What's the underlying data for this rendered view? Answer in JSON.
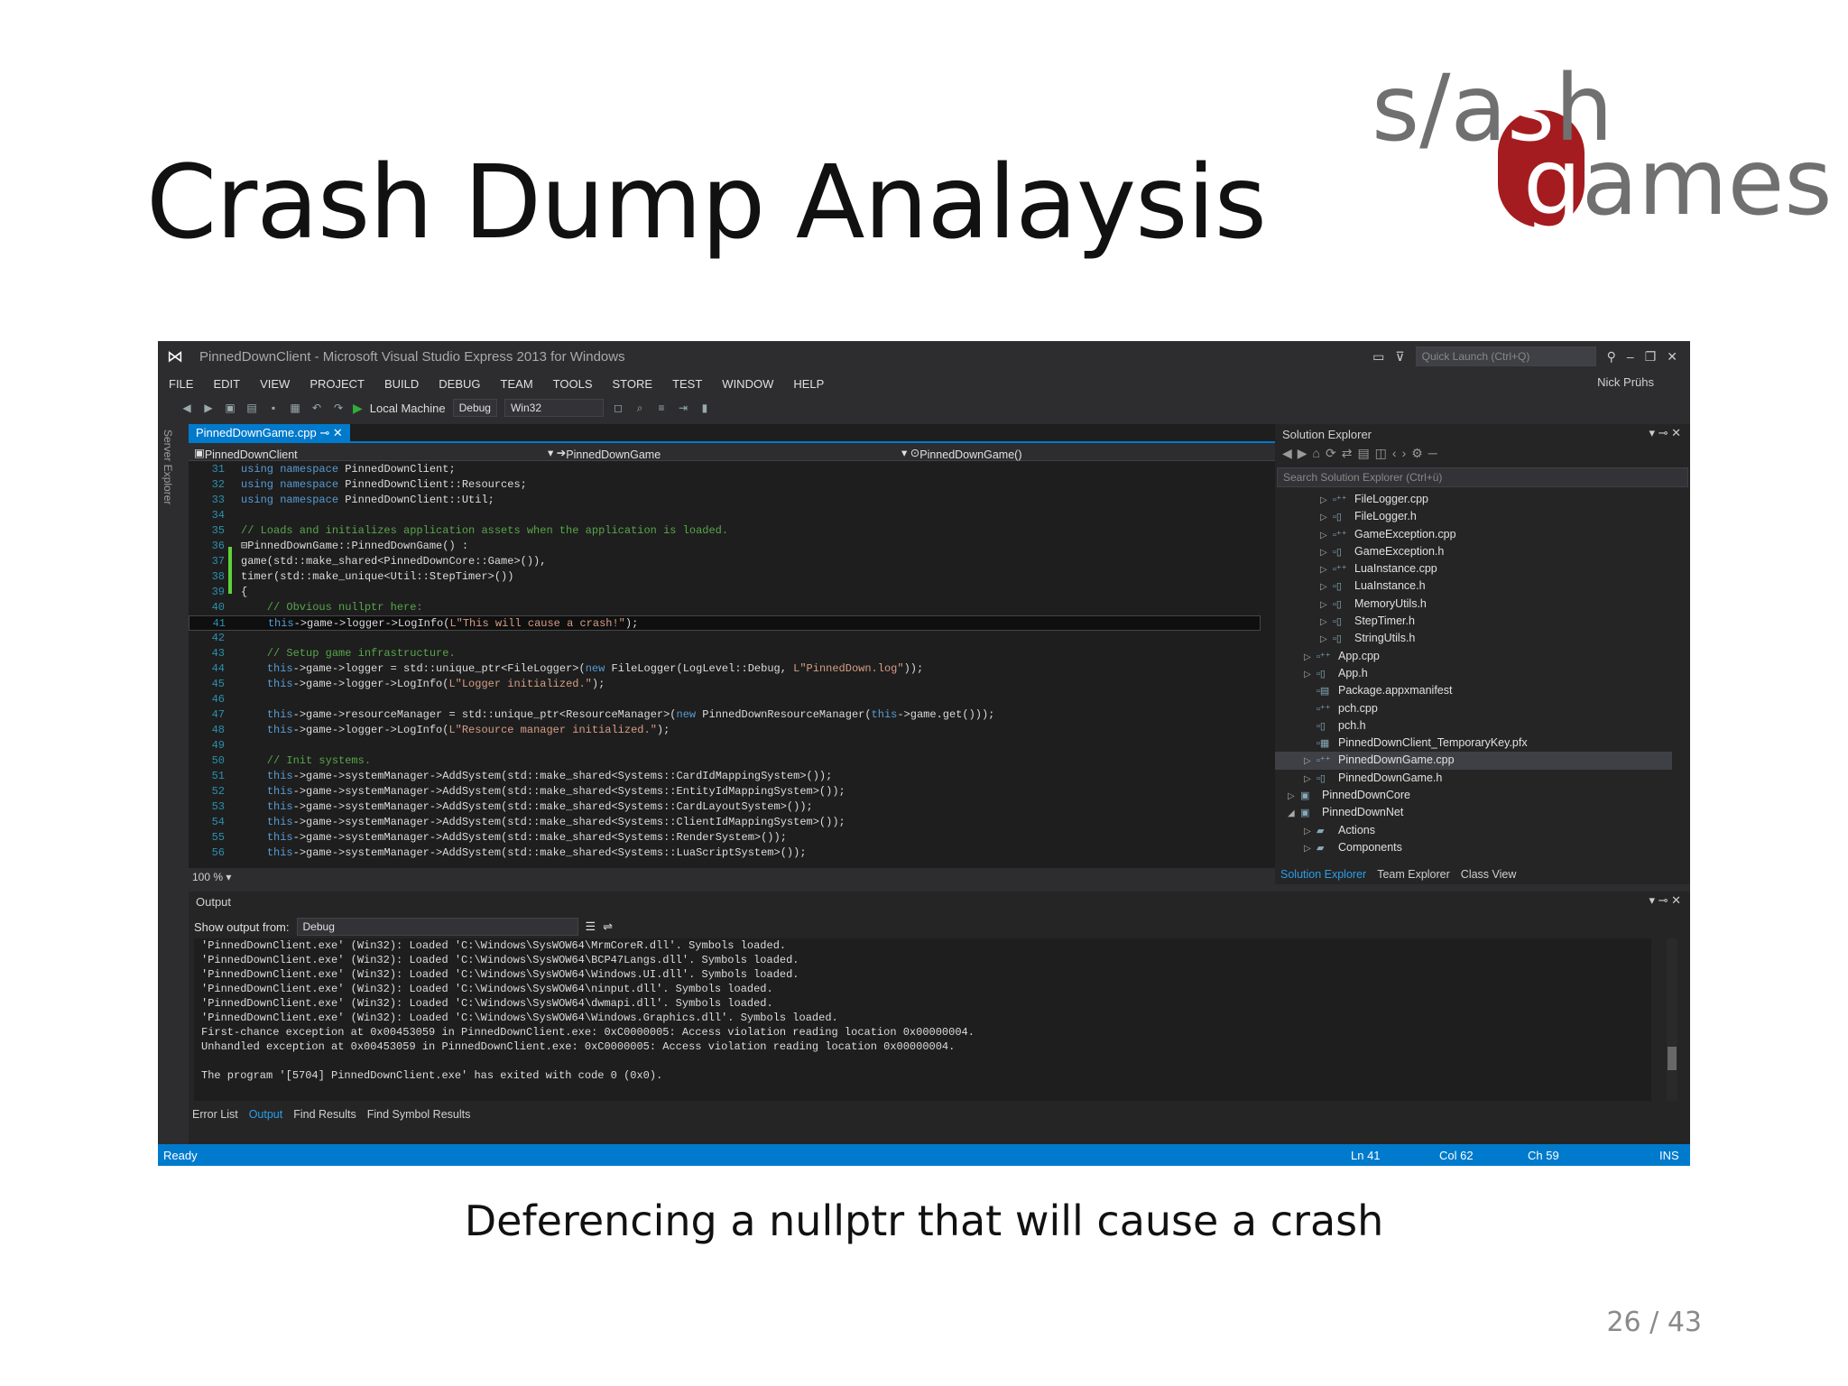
{
  "slide": {
    "title": "Crash Dump Analaysis",
    "caption": "Deferencing a nullptr that will cause a crash",
    "page": "26 / 43",
    "logo": {
      "top": "s/ash",
      "bottom": "games",
      "accent": "#a41c1f"
    }
  },
  "window": {
    "title": "PinnedDownClient - Microsoft Visual Studio Express 2013 for Windows",
    "quick_launch_placeholder": "Quick Launch (Ctrl+Q)",
    "user": "Nick Prühs"
  },
  "menu": [
    "FILE",
    "EDIT",
    "VIEW",
    "PROJECT",
    "BUILD",
    "DEBUG",
    "TEAM",
    "TOOLS",
    "STORE",
    "TEST",
    "WINDOW",
    "HELP"
  ],
  "toolbar": {
    "run_target": "Local Machine",
    "configuration": "Debug",
    "platform": "Win32"
  },
  "sidebar_tab": "Server Explorer",
  "editor": {
    "tab": "PinnedDownGame.cpp",
    "nav_project": "PinnedDownClient",
    "nav_class": "PinnedDownGame",
    "nav_member": "PinnedDownGame()",
    "zoom": "100 %",
    "lines": [
      {
        "n": "31",
        "t": "using namespace PinnedDownClient;"
      },
      {
        "n": "32",
        "t": "using namespace PinnedDownClient::Resources;"
      },
      {
        "n": "33",
        "t": "using namespace PinnedDownClient::Util;"
      },
      {
        "n": "34",
        "t": ""
      },
      {
        "n": "35",
        "t": "// Loads and initializes application assets when the application is loaded."
      },
      {
        "n": "36",
        "t": "⊟PinnedDownGame::PinnedDownGame() :"
      },
      {
        "n": "37",
        "t": "game(std::make_shared<PinnedDownCore::Game>()),"
      },
      {
        "n": "38",
        "t": "timer(std::make_unique<Util::StepTimer>())"
      },
      {
        "n": "39",
        "t": "{"
      },
      {
        "n": "40",
        "t": "    // Obvious nullptr here:"
      },
      {
        "n": "41",
        "t": "    this->game->logger->LogInfo(L\"This will cause a crash!\");"
      },
      {
        "n": "42",
        "t": ""
      },
      {
        "n": "43",
        "t": "    // Setup game infrastructure."
      },
      {
        "n": "44",
        "t": "    this->game->logger = std::unique_ptr<FileLogger>(new FileLogger(LogLevel::Debug, L\"PinnedDown.log\"));"
      },
      {
        "n": "45",
        "t": "    this->game->logger->LogInfo(L\"Logger initialized.\");"
      },
      {
        "n": "46",
        "t": ""
      },
      {
        "n": "47",
        "t": "    this->game->resourceManager = std::unique_ptr<ResourceManager>(new PinnedDownResourceManager(this->game.get()));"
      },
      {
        "n": "48",
        "t": "    this->game->logger->LogInfo(L\"Resource manager initialized.\");"
      },
      {
        "n": "49",
        "t": ""
      },
      {
        "n": "50",
        "t": "    // Init systems."
      },
      {
        "n": "51",
        "t": "    this->game->systemManager->AddSystem(std::make_shared<Systems::CardIdMappingSystem>());"
      },
      {
        "n": "52",
        "t": "    this->game->systemManager->AddSystem(std::make_shared<Systems::EntityIdMappingSystem>());"
      },
      {
        "n": "53",
        "t": "    this->game->systemManager->AddSystem(std::make_shared<Systems::CardLayoutSystem>());"
      },
      {
        "n": "54",
        "t": "    this->game->systemManager->AddSystem(std::make_shared<Systems::ClientIdMappingSystem>());"
      },
      {
        "n": "55",
        "t": "    this->game->systemManager->AddSystem(std::make_shared<Systems::RenderSystem>());"
      },
      {
        "n": "56",
        "t": "    this->game->systemManager->AddSystem(std::make_shared<Systems::LuaScriptSystem>());"
      }
    ]
  },
  "solution_explorer": {
    "title": "Solution Explorer",
    "search_placeholder": "Search Solution Explorer (Ctrl+ü)",
    "items": [
      {
        "label": "FileLogger.cpp",
        "depth": 3,
        "arrow": "▷",
        "icon": "cpp-file-icon"
      },
      {
        "label": "FileLogger.h",
        "depth": 3,
        "arrow": "▷",
        "icon": "header-file-icon"
      },
      {
        "label": "GameException.cpp",
        "depth": 3,
        "arrow": "▷",
        "icon": "cpp-file-icon"
      },
      {
        "label": "GameException.h",
        "depth": 3,
        "arrow": "▷",
        "icon": "header-file-icon"
      },
      {
        "label": "LuaInstance.cpp",
        "depth": 3,
        "arrow": "▷",
        "icon": "cpp-file-icon"
      },
      {
        "label": "LuaInstance.h",
        "depth": 3,
        "arrow": "▷",
        "icon": "header-file-icon"
      },
      {
        "label": "MemoryUtils.h",
        "depth": 3,
        "arrow": "▷",
        "icon": "header-file-icon"
      },
      {
        "label": "StepTimer.h",
        "depth": 3,
        "arrow": "▷",
        "icon": "header-file-icon"
      },
      {
        "label": "StringUtils.h",
        "depth": 3,
        "arrow": "▷",
        "icon": "header-file-icon"
      },
      {
        "label": "App.cpp",
        "depth": 2,
        "arrow": "▷",
        "icon": "cpp-file-icon"
      },
      {
        "label": "App.h",
        "depth": 2,
        "arrow": "▷",
        "icon": "header-file-icon"
      },
      {
        "label": "Package.appxmanifest",
        "depth": 2,
        "arrow": "",
        "icon": "manifest-file-icon"
      },
      {
        "label": "pch.cpp",
        "depth": 2,
        "arrow": "",
        "icon": "cpp-file-icon"
      },
      {
        "label": "pch.h",
        "depth": 2,
        "arrow": "",
        "icon": "header-file-icon"
      },
      {
        "label": "PinnedDownClient_TemporaryKey.pfx",
        "depth": 2,
        "arrow": "",
        "icon": "certificate-file-icon"
      },
      {
        "label": "PinnedDownGame.cpp",
        "depth": 2,
        "arrow": "▷",
        "icon": "cpp-file-icon",
        "selected": true
      },
      {
        "label": "PinnedDownGame.h",
        "depth": 2,
        "arrow": "▷",
        "icon": "header-file-icon"
      },
      {
        "label": "PinnedDownCore",
        "depth": 1,
        "arrow": "▷",
        "icon": "project-icon"
      },
      {
        "label": "PinnedDownNet",
        "depth": 1,
        "arrow": "◢",
        "icon": "project-icon"
      },
      {
        "label": "Actions",
        "depth": 2,
        "arrow": "▷",
        "icon": "folder-icon"
      },
      {
        "label": "Components",
        "depth": 2,
        "arrow": "▷",
        "icon": "folder-icon"
      }
    ],
    "tabs": [
      "Solution Explorer",
      "Team Explorer",
      "Class View"
    ]
  },
  "output": {
    "title": "Output",
    "show_from_label": "Show output from:",
    "source": "Debug",
    "lines": [
      "'PinnedDownClient.exe' (Win32): Loaded 'C:\\Windows\\SysWOW64\\MrmCoreR.dll'. Symbols loaded.",
      "'PinnedDownClient.exe' (Win32): Loaded 'C:\\Windows\\SysWOW64\\BCP47Langs.dll'. Symbols loaded.",
      "'PinnedDownClient.exe' (Win32): Loaded 'C:\\Windows\\SysWOW64\\Windows.UI.dll'. Symbols loaded.",
      "'PinnedDownClient.exe' (Win32): Loaded 'C:\\Windows\\SysWOW64\\ninput.dll'. Symbols loaded.",
      "'PinnedDownClient.exe' (Win32): Loaded 'C:\\Windows\\SysWOW64\\dwmapi.dll'. Symbols loaded.",
      "'PinnedDownClient.exe' (Win32): Loaded 'C:\\Windows\\SysWOW64\\Windows.Graphics.dll'. Symbols loaded.",
      "First-chance exception at 0x00453059 in PinnedDownClient.exe: 0xC0000005: Access violation reading location 0x00000004.",
      "Unhandled exception at 0x00453059 in PinnedDownClient.exe: 0xC0000005: Access violation reading location 0x00000004.",
      "",
      "The program '[5704] PinnedDownClient.exe' has exited with code 0 (0x0)."
    ],
    "tabs": [
      "Error List",
      "Output",
      "Find Results",
      "Find Symbol Results"
    ]
  },
  "status": {
    "state": "Ready",
    "ln": "Ln 41",
    "col": "Col 62",
    "ch": "Ch 59",
    "mode": "INS"
  }
}
